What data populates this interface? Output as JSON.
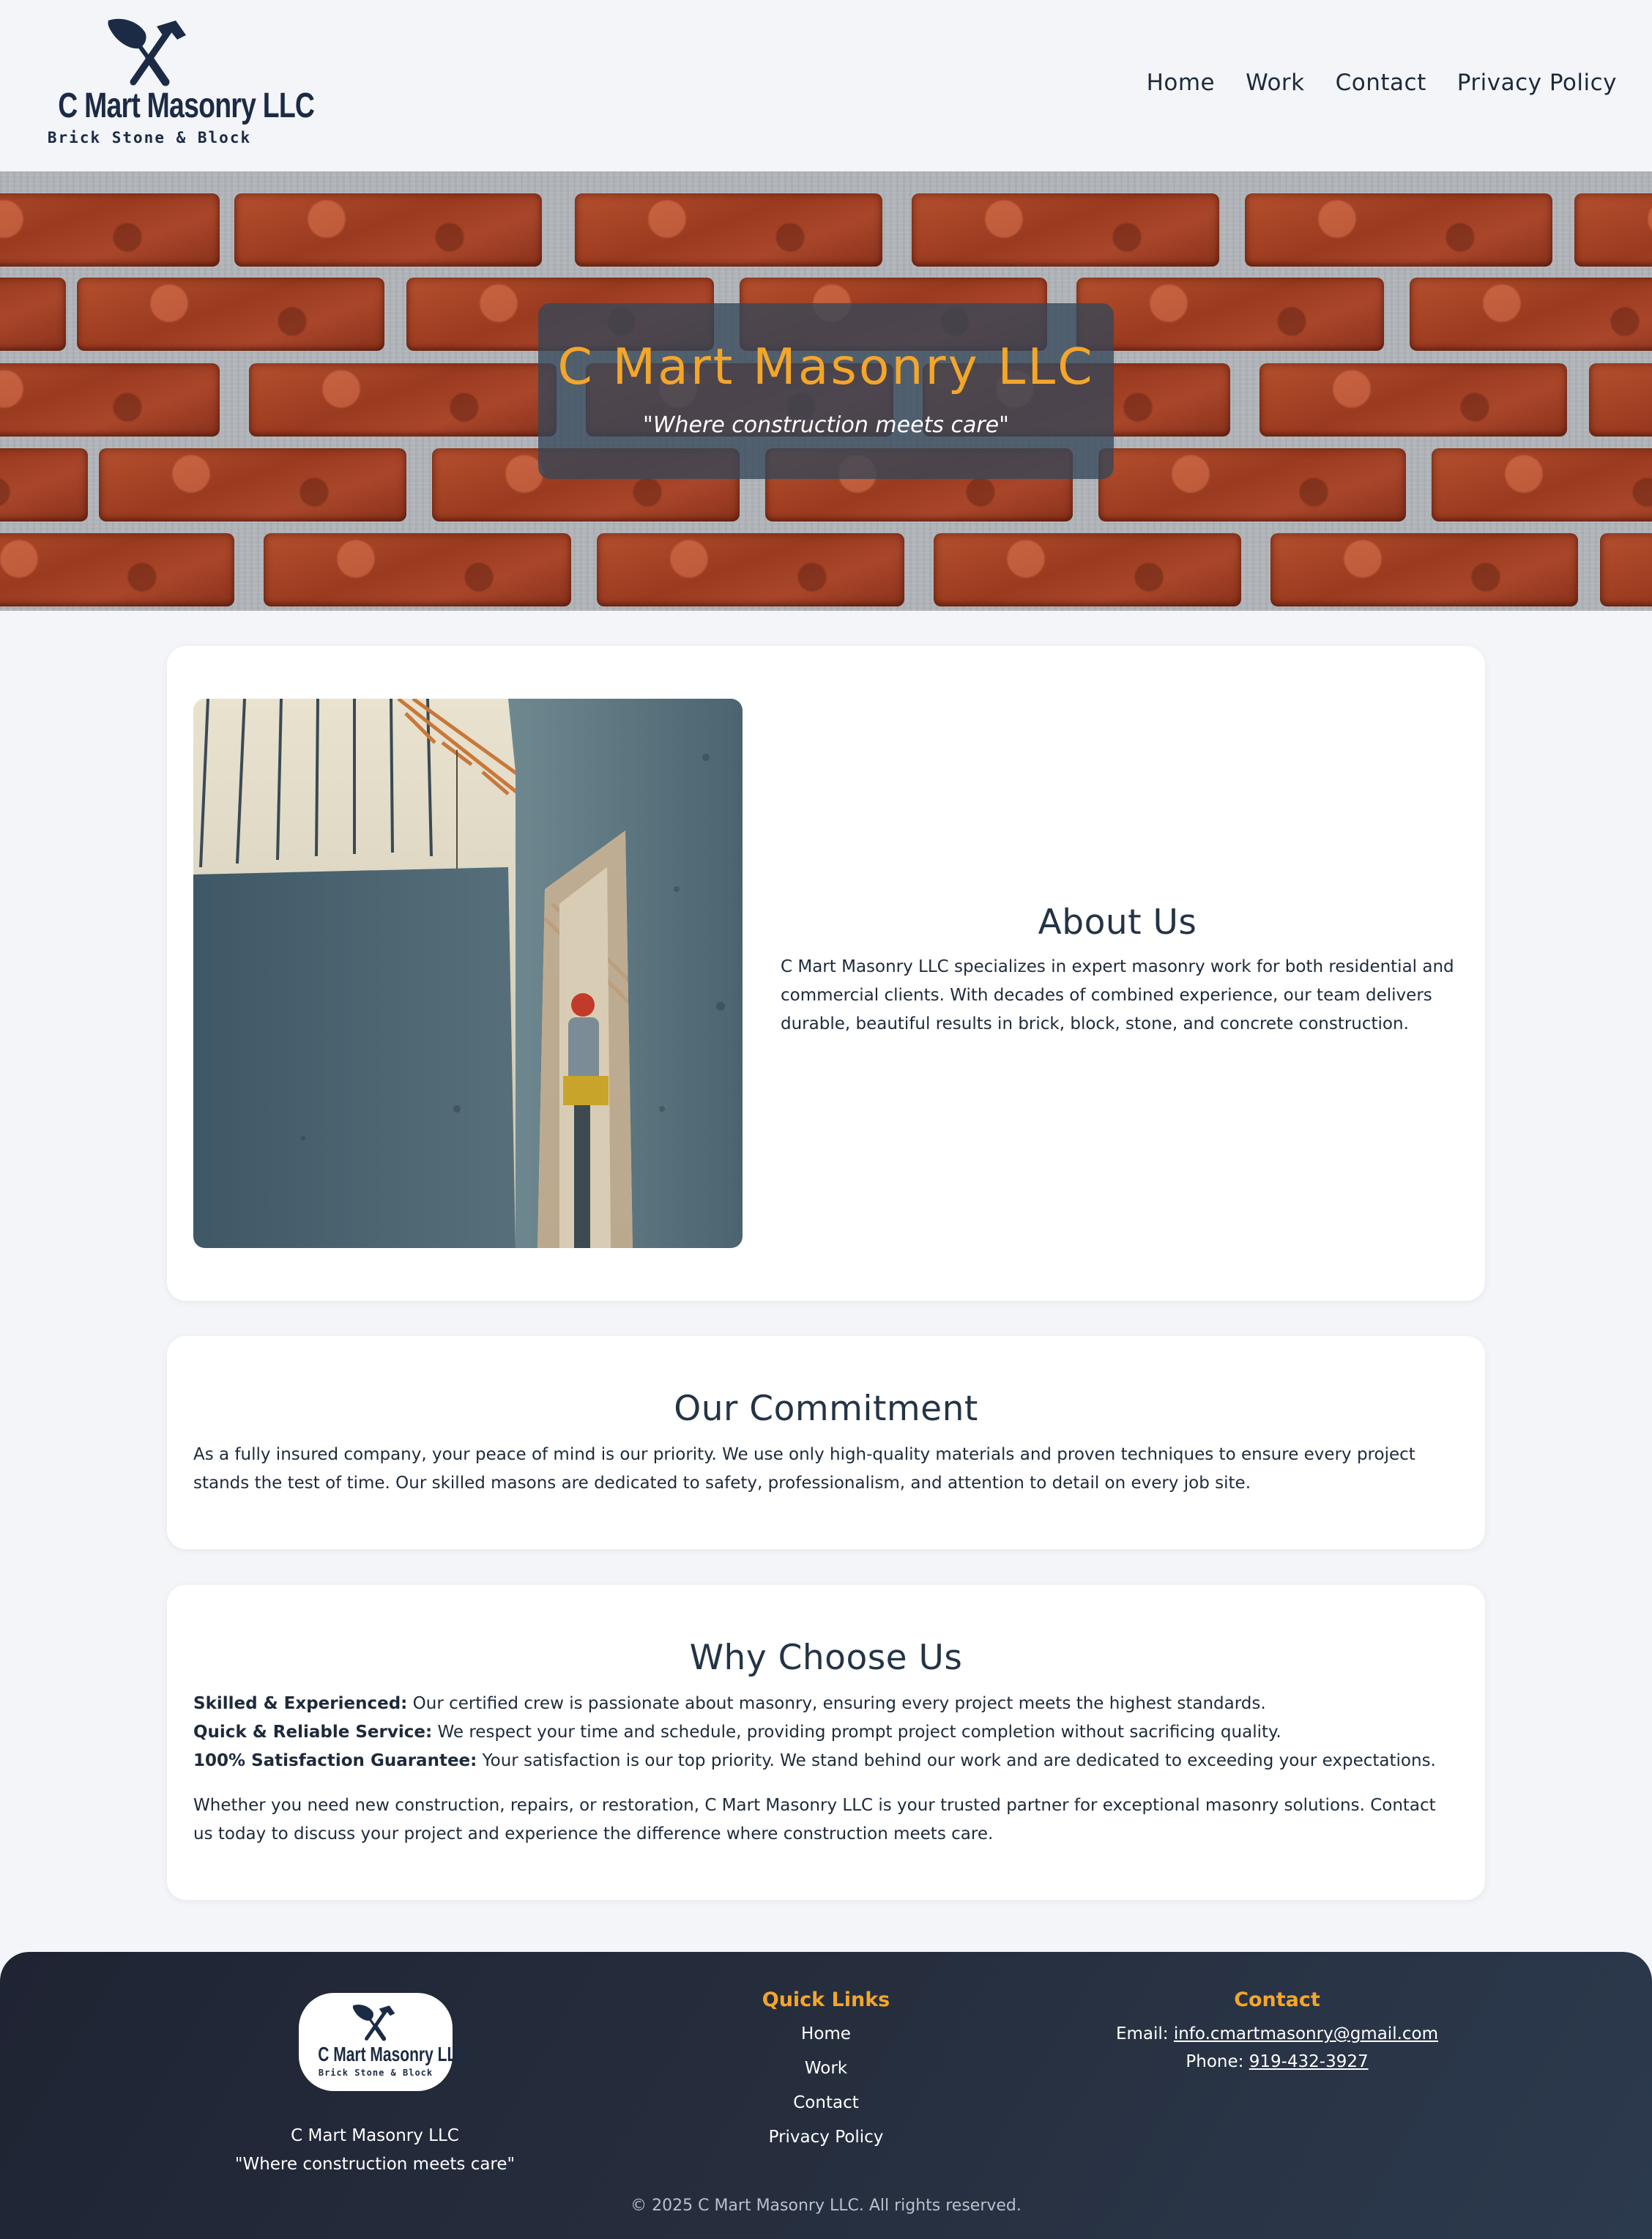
{
  "brand": {
    "name": "C Mart Masonry LLC",
    "sub": "Brick Stone & Block",
    "tagline": "\"Where construction meets care\""
  },
  "nav": {
    "items": [
      "Home",
      "Work",
      "Contact",
      "Privacy Policy"
    ]
  },
  "hero": {
    "title": "C Mart Masonry LLC",
    "tagline": "\"Where construction meets care\""
  },
  "about": {
    "heading": "About Us",
    "body": "C Mart Masonry LLC specializes in expert masonry work for both residential and commercial clients. With decades of combined experience, our team delivers durable, beautiful results in brick, block, stone, and concrete construction."
  },
  "commitment": {
    "heading": "Our Commitment",
    "body": "As a fully insured company, your peace of mind is our priority. We use only high-quality materials and proven techniques to ensure every project stands the test of time. Our skilled masons are dedicated to safety, professionalism, and attention to detail on every job site."
  },
  "why": {
    "heading": "Why Choose Us",
    "items": [
      {
        "label": "Skilled & Experienced:",
        "text": " Our certified crew is passionate about masonry, ensuring every project meets the highest standards."
      },
      {
        "label": "Quick & Reliable Service:",
        "text": " We respect your time and schedule, providing prompt project completion without sacrificing quality."
      },
      {
        "label": "100% Satisfaction Guarantee:",
        "text": " Your satisfaction is our top priority. We stand behind our work and are dedicated to exceeding your expectations."
      }
    ],
    "closing": "Whether you need new construction, repairs, or restoration, C Mart Masonry LLC is your trusted partner for exceptional masonry solutions. Contact us today to discuss your project and experience the difference where construction meets care."
  },
  "footer": {
    "brand_name": "C Mart Masonry LLC",
    "brand_tagline": "\"Where construction meets care\"",
    "quick_links_heading": "Quick Links",
    "quick_links": [
      "Home",
      "Work",
      "Contact",
      "Privacy Policy"
    ],
    "contact_heading": "Contact",
    "email_label": "Email: ",
    "email": "info.cmartmasonry@gmail.com",
    "phone_label": "Phone: ",
    "phone": "919-432-3927",
    "copyright": "© 2025 C Mart Masonry LLC. All rights reserved."
  },
  "colors": {
    "accent": "#f4a62a",
    "navy": "#1c2b45",
    "page_bg": "#f3f5f9"
  },
  "icons": {
    "logo": "trowel-hammer-icon"
  }
}
